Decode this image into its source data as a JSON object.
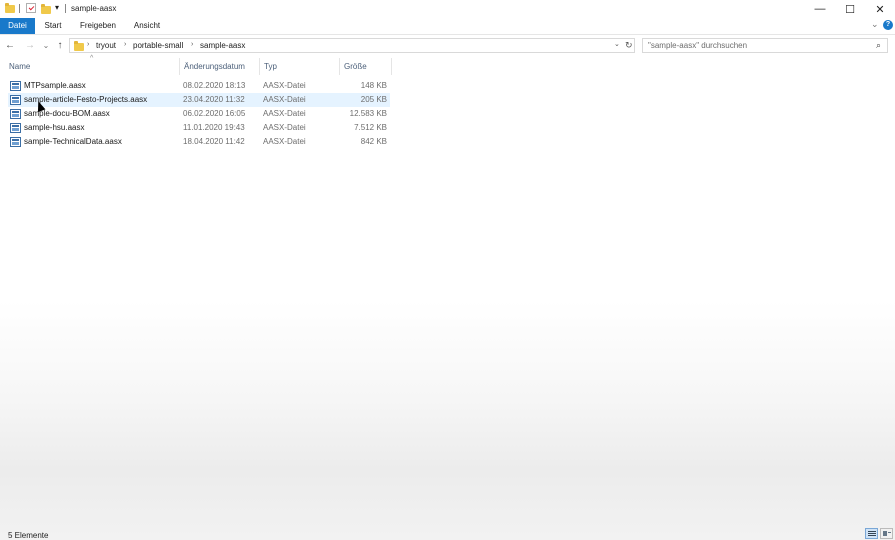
{
  "window": {
    "title": "sample-aasx",
    "minimize_glyph": "—",
    "maximize_glyph": "☐",
    "close_glyph": "✕"
  },
  "ribbon": {
    "tabs": [
      "Datei",
      "Start",
      "Freigeben",
      "Ansicht"
    ],
    "accent": "#1979ca"
  },
  "nav": {
    "back_glyph": "←",
    "forward_glyph": "→",
    "recent_glyph": "⌄",
    "up_glyph": "↑"
  },
  "breadcrumb": [
    "tryout",
    "portable-small",
    "sample-aasx"
  ],
  "search": {
    "placeholder": "\"sample-aasx\" durchsuchen"
  },
  "columns": {
    "name": "Name",
    "date": "Änderungsdatum",
    "type": "Typ",
    "size": "Größe"
  },
  "files": [
    {
      "name": "MTPsample.aasx",
      "date": "08.02.2020 18:13",
      "type": "AASX-Datei",
      "size": "148 KB"
    },
    {
      "name": "sample-article-Festo-Projects.aasx",
      "date": "23.04.2020 11:32",
      "type": "AASX-Datei",
      "size": "205 KB"
    },
    {
      "name": "sample-docu-BOM.aasx",
      "date": "06.02.2020 16:05",
      "type": "AASX-Datei",
      "size": "12.583 KB"
    },
    {
      "name": "sample-hsu.aasx",
      "date": "11.01.2020 19:43",
      "type": "AASX-Datei",
      "size": "7.512 KB"
    },
    {
      "name": "sample-TechnicalData.aasx",
      "date": "18.04.2020 11:42",
      "type": "AASX-Datei",
      "size": "842 KB"
    }
  ],
  "status": {
    "count": "5 Elemente"
  }
}
